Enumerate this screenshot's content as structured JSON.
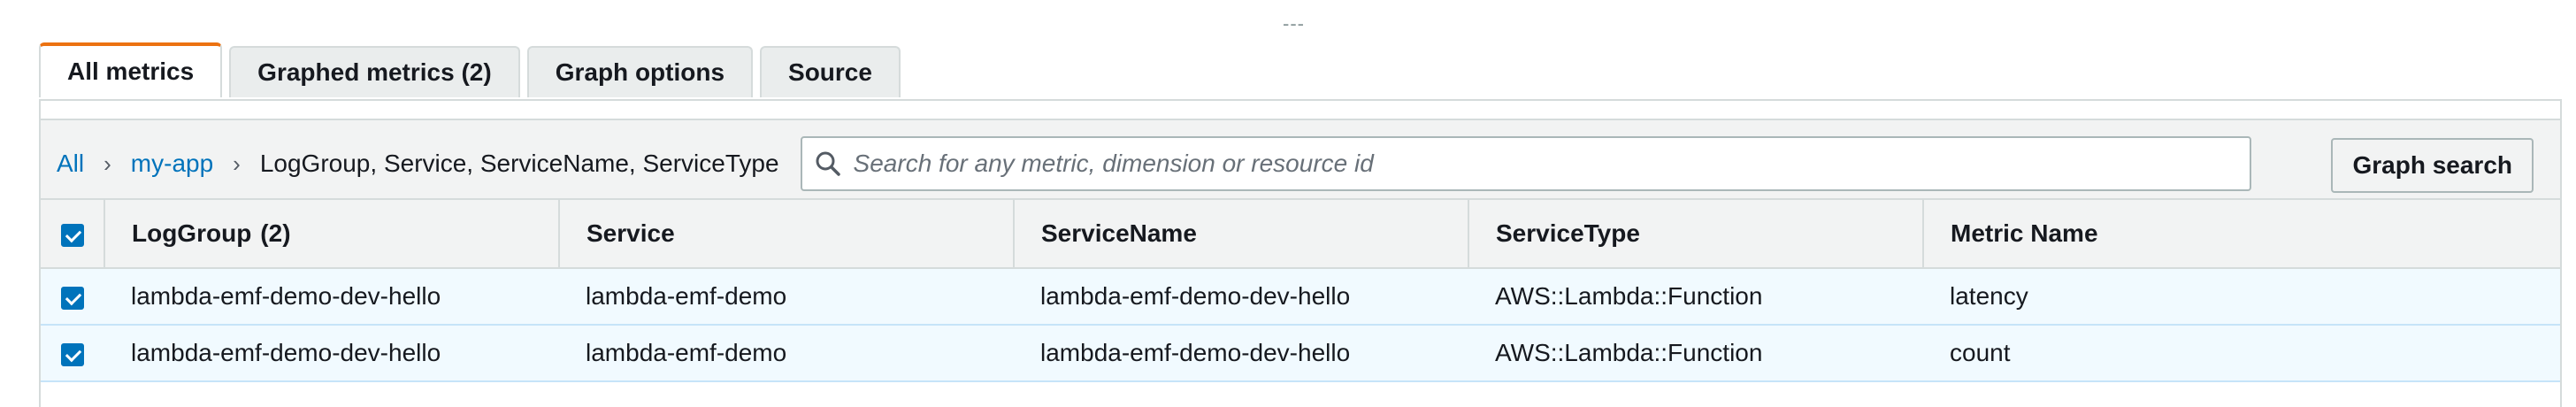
{
  "drag_handle": "---",
  "tabs": [
    {
      "label": "All metrics",
      "active": true
    },
    {
      "label": "Graphed metrics (2)",
      "active": false
    },
    {
      "label": "Graph options",
      "active": false
    },
    {
      "label": "Source",
      "active": false
    }
  ],
  "breadcrumb": {
    "root": "All",
    "namespace": "my-app",
    "dimensions": "LogGroup, Service, ServiceName, ServiceType"
  },
  "search": {
    "placeholder": "Search for any metric, dimension or resource id",
    "value": ""
  },
  "graph_search_label": "Graph search",
  "table": {
    "select_all_checked": true,
    "columns": [
      {
        "label": "LogGroup",
        "count": "(2)"
      },
      {
        "label": "Service",
        "count": ""
      },
      {
        "label": "ServiceName",
        "count": ""
      },
      {
        "label": "ServiceType",
        "count": ""
      },
      {
        "label": "Metric Name",
        "count": ""
      }
    ],
    "rows": [
      {
        "checked": true,
        "cells": [
          "lambda-emf-demo-dev-hello",
          "lambda-emf-demo",
          "lambda-emf-demo-dev-hello",
          "AWS::Lambda::Function",
          "latency"
        ]
      },
      {
        "checked": true,
        "cells": [
          "lambda-emf-demo-dev-hello",
          "lambda-emf-demo",
          "lambda-emf-demo-dev-hello",
          "AWS::Lambda::Function",
          "count"
        ]
      }
    ]
  },
  "colors": {
    "accent_tab": "#ec7211",
    "link": "#0073bb",
    "selected_row_bg": "#f1faff"
  },
  "icons": {
    "search": "search-icon",
    "breadcrumb_separator": "chevron-right-icon",
    "checkbox": "checkbox-checked-icon"
  }
}
